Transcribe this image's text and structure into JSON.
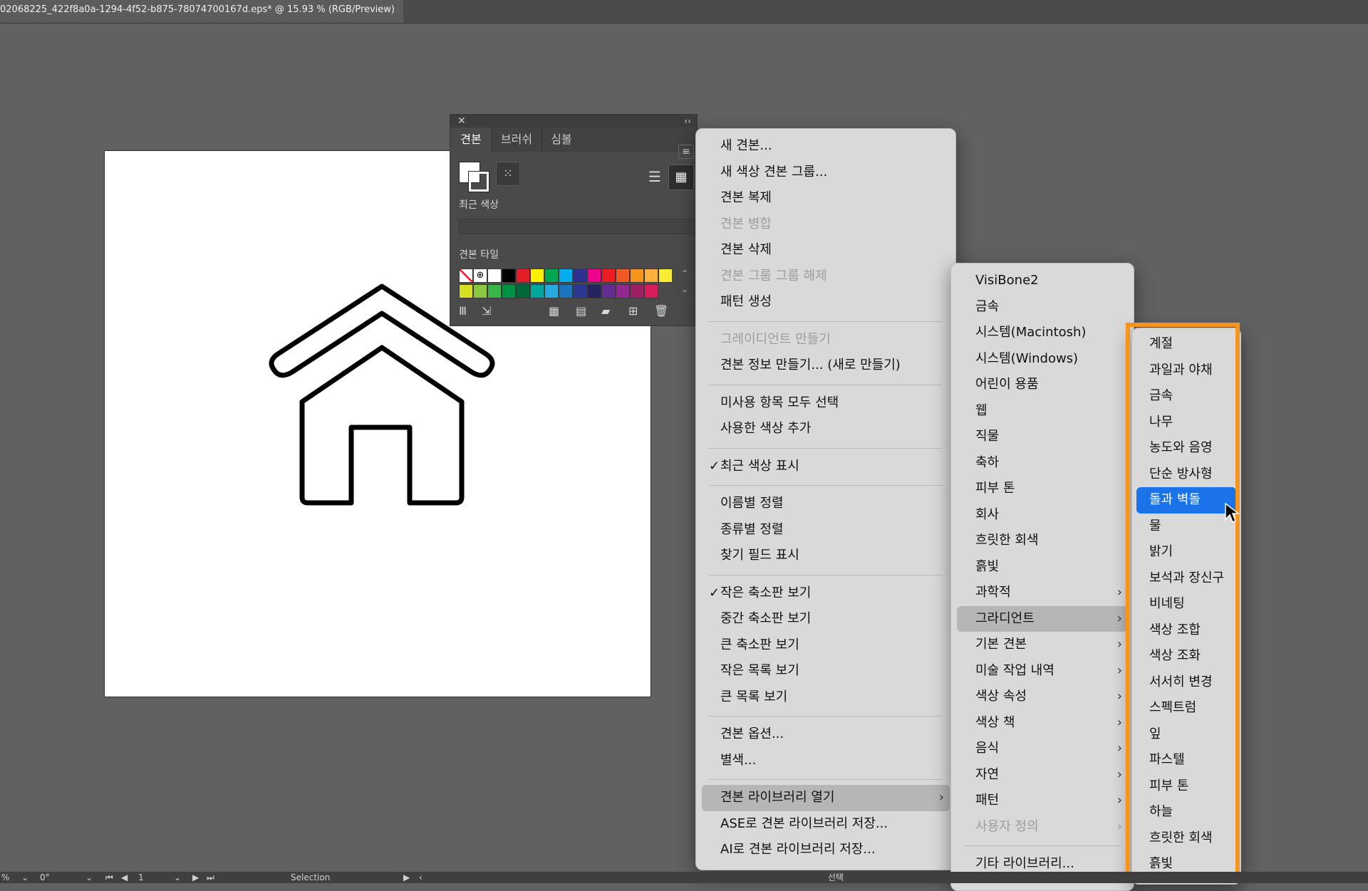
{
  "window": {
    "doc_tab": "02068225_422f8a0a-1294-4f52-b875-78074700167d.eps* @ 15.93 % (RGB/Preview)"
  },
  "swatches_panel": {
    "tabs": [
      "견본",
      "브러쉬",
      "심볼"
    ],
    "recent_label": "최근 색상",
    "tile_label": "견본 타일",
    "chips": [
      "none",
      "registration",
      "#ffffff",
      "#000000",
      "#e41e26",
      "#fff200",
      "#00a651",
      "#00aeef",
      "#2e3192",
      "#ec008c",
      "#ed1c24",
      "#f15a24",
      "#f7941d",
      "#fbb040",
      "#f9ed32",
      "#d7df23",
      "#8dc63f",
      "#39b54a",
      "#009444",
      "#006838",
      "#00a79d",
      "#27aae1",
      "#1c75bc",
      "#2b3990",
      "#262262",
      "#662d91",
      "#92278f",
      "#9e1f63",
      "#da1c5c"
    ]
  },
  "menu_main": {
    "items": [
      {
        "label": "새 견본...",
        "disabled": false,
        "check": false,
        "submenu": false
      },
      {
        "label": "새 색상 견본 그룹...",
        "disabled": false,
        "check": false,
        "submenu": false
      },
      {
        "label": "견본 복제",
        "disabled": false,
        "check": false,
        "submenu": false
      },
      {
        "label": "견본 병합",
        "disabled": true,
        "check": false,
        "submenu": false
      },
      {
        "label": "견본 삭제",
        "disabled": false,
        "check": false,
        "submenu": false
      },
      {
        "label": "견본 그룹 그룹 해제",
        "disabled": true,
        "check": false,
        "submenu": false
      },
      {
        "label": "패턴 생성",
        "disabled": false,
        "check": false,
        "submenu": false
      },
      {
        "label": "그레이디언트 만들기",
        "disabled": true,
        "check": false,
        "submenu": false
      },
      {
        "label": "견본 정보 만들기... (새로 만들기)",
        "disabled": false,
        "check": false,
        "submenu": false
      },
      {
        "label": "미사용 항목 모두 선택",
        "disabled": false,
        "check": false,
        "submenu": false
      },
      {
        "label": "사용한 색상 추가",
        "disabled": false,
        "check": false,
        "submenu": false
      },
      {
        "label": "최근 색상 표시",
        "disabled": false,
        "check": true,
        "submenu": false
      },
      {
        "label": "이름별 정렬",
        "disabled": false,
        "check": false,
        "submenu": false
      },
      {
        "label": "종류별 정렬",
        "disabled": false,
        "check": false,
        "submenu": false
      },
      {
        "label": "찾기 필드 표시",
        "disabled": false,
        "check": false,
        "submenu": false
      },
      {
        "label": "작은 축소판 보기",
        "disabled": false,
        "check": true,
        "submenu": false
      },
      {
        "label": "중간 축소판 보기",
        "disabled": false,
        "check": false,
        "submenu": false
      },
      {
        "label": "큰 축소판 보기",
        "disabled": false,
        "check": false,
        "submenu": false
      },
      {
        "label": "작은 목록 보기",
        "disabled": false,
        "check": false,
        "submenu": false
      },
      {
        "label": "큰 목록 보기",
        "disabled": false,
        "check": false,
        "submenu": false
      },
      {
        "label": "견본 옵션...",
        "disabled": false,
        "check": false,
        "submenu": false
      },
      {
        "label": "별색...",
        "disabled": false,
        "check": false,
        "submenu": false
      },
      {
        "label": "견본 라이브러리 열기",
        "disabled": false,
        "check": false,
        "submenu": true,
        "hover": true
      },
      {
        "label": "ASE로 견본 라이브러리 저장...",
        "disabled": false,
        "check": false,
        "submenu": false
      },
      {
        "label": "AI로 견본 라이브러리 저장...",
        "disabled": false,
        "check": false,
        "submenu": false
      }
    ]
  },
  "menu_libraries": {
    "items": [
      {
        "label": "VisiBone2",
        "submenu": false
      },
      {
        "label": "금속",
        "submenu": false
      },
      {
        "label": "시스템(Macintosh)",
        "submenu": false
      },
      {
        "label": "시스템(Windows)",
        "submenu": false
      },
      {
        "label": "어린이 용품",
        "submenu": false
      },
      {
        "label": "웹",
        "submenu": false
      },
      {
        "label": "직물",
        "submenu": false
      },
      {
        "label": "축하",
        "submenu": false
      },
      {
        "label": "피부 톤",
        "submenu": false
      },
      {
        "label": "회사",
        "submenu": false
      },
      {
        "label": "흐릿한 회색",
        "submenu": false
      },
      {
        "label": "흙빛",
        "submenu": false
      },
      {
        "label": "과학적",
        "submenu": true
      },
      {
        "label": "그라디언트",
        "submenu": true,
        "hover": true
      },
      {
        "label": "기본 견본",
        "submenu": true
      },
      {
        "label": "미술 작업 내역",
        "submenu": true
      },
      {
        "label": "색상 속성",
        "submenu": true
      },
      {
        "label": "색상 책",
        "submenu": true
      },
      {
        "label": "음식",
        "submenu": true
      },
      {
        "label": "자연",
        "submenu": true
      },
      {
        "label": "패턴",
        "submenu": true
      },
      {
        "label": "사용자 정의",
        "submenu": true,
        "disabled": true
      },
      {
        "label": "기타 라이브러리...",
        "submenu": false
      }
    ]
  },
  "menu_gradients": {
    "items": [
      "계절",
      "과일과 야채",
      "금속",
      "나무",
      "농도와 음영",
      "단순 방사형",
      "돌과 벽돌",
      "물",
      "밝기",
      "보석과 장신구",
      "비네팅",
      "색상 조합",
      "색상 조화",
      "서서히 변경",
      "스펙트럼",
      "잎",
      "파스텔",
      "피부 톤",
      "하늘",
      "흐릿한 회색",
      "흙빛"
    ],
    "selected": "돌과 벽돌"
  },
  "status": {
    "zoom": "%",
    "angle": "0°",
    "artboard_index": "1",
    "tool": "Selection",
    "right": "선택"
  },
  "colors": {
    "highlight": "#f7941d",
    "selection": "#1a73e8"
  }
}
